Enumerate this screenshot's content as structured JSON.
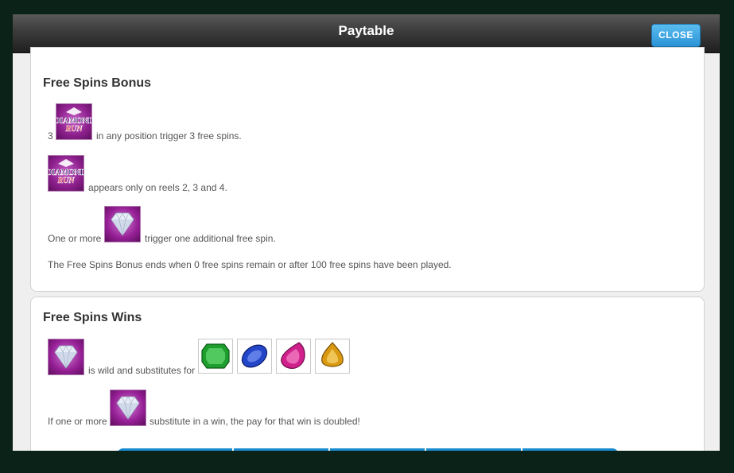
{
  "header": {
    "title": "Paytable",
    "close_label": "CLOSE"
  },
  "free_spins_bonus": {
    "heading": "Free Spins Bonus",
    "line1_prefix": "3",
    "line1_suffix": "in any position trigger 3 free spins.",
    "line2_suffix": "appears only on reels 2, 3 and 4.",
    "line3_prefix": "One or more",
    "line3_suffix": "trigger one additional free spin.",
    "line4": "The Free Spins Bonus ends when 0 free spins remain or after 100 free spins have been played.",
    "scatter_logo_text": [
      "DIAMOND",
      "RUN"
    ]
  },
  "free_spins_wins": {
    "heading": "Free Spins Wins",
    "line1_suffix": "is wild and substitutes for",
    "line2_prefix": "If one or more",
    "line2_suffix": "substitute in a win, the pay for that win is doubled!",
    "substituted_symbols": [
      "green-emerald-icon",
      "blue-sapphire-icon",
      "pink-ruby-icon",
      "yellow-topaz-icon"
    ]
  },
  "colors": {
    "accent": "#2a93d6",
    "symbol_bg": "#8c1f8c",
    "table_header": "#1a8bd0"
  }
}
